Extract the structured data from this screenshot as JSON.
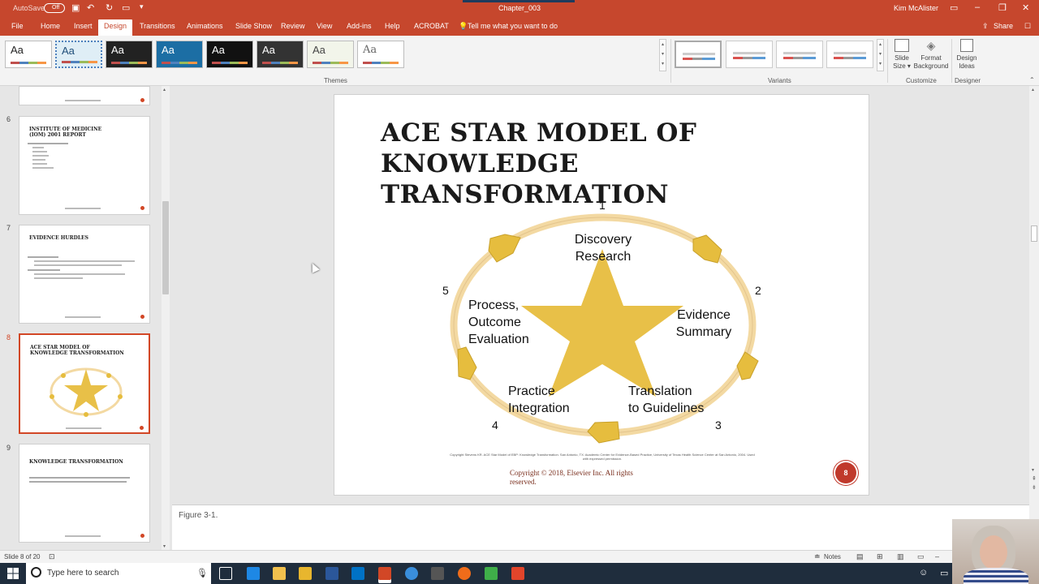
{
  "window": {
    "autosave_label": "AutoSave",
    "autosave_state": "Off",
    "file_title": "Chapter_003",
    "user_name": "Kim McAlister"
  },
  "tabs": [
    "File",
    "Home",
    "Insert",
    "Design",
    "Transitions",
    "Animations",
    "Slide Show",
    "Review",
    "View",
    "Add-ins",
    "Help",
    "ACROBAT"
  ],
  "active_tab": "Design",
  "tell_me": "Tell me what you want to do",
  "share_label": "Share",
  "ribbon": {
    "theme_sample": "Aa",
    "themes_group": "Themes",
    "variants_group": "Variants",
    "customize_group": "Customize",
    "designer_group": "Designer",
    "slide_size": "Slide Size",
    "format_background": "Format Background",
    "design_ideas": "Design Ideas"
  },
  "thumbnails": [
    {
      "num": "6",
      "title": "INSTITUTE OF MEDICINE (IOM) 2001 REPORT"
    },
    {
      "num": "7",
      "title": "EVIDENCE HURDLES"
    },
    {
      "num": "8",
      "title": "ACE STAR MODEL OF KNOWLEDGE TRANSFORMATION"
    },
    {
      "num": "9",
      "title": "KNOWLEDGE TRANSFORMATION"
    }
  ],
  "slide": {
    "title_line1": "ACE STAR MODEL OF KNOWLEDGE",
    "title_line2": "TRANSFORMATION",
    "stages": {
      "n1": "1",
      "n2": "2",
      "n3": "3",
      "n4": "4",
      "n5": "5",
      "s1a": "Discovery",
      "s1b": "Research",
      "s2a": "Evidence",
      "s2b": "Summary",
      "s3a": "Translation",
      "s3b": "to Guidelines",
      "s4a": "Practice",
      "s4b": "Integration",
      "s5a": "Process,",
      "s5b": "Outcome",
      "s5c": "Evaluation"
    },
    "credit": "Copyright Stevens KR. ACE Star Model of EBP: Knowledge Transformation. San Antonio, TX: Academic Center for Evidence-Based Practice, University of Texas Health Science Center at San Antonio, 2004. Used with expressed permission.",
    "copyright_line1": "Copyright © 2018, Elsevier Inc. All rights",
    "copyright_line2": "reserved.",
    "page_badge": "8",
    "colors": {
      "star": "#e8c048",
      "ring": "#f3d9a2",
      "pentagon": "#e6bd3e",
      "accent": "#c6472d"
    }
  },
  "notes_text": "Figure 3-1.",
  "status": {
    "slide_info": "Slide 8 of 20",
    "notes_label": "Notes"
  },
  "taskbar": {
    "search_placeholder": "Type here to search"
  }
}
